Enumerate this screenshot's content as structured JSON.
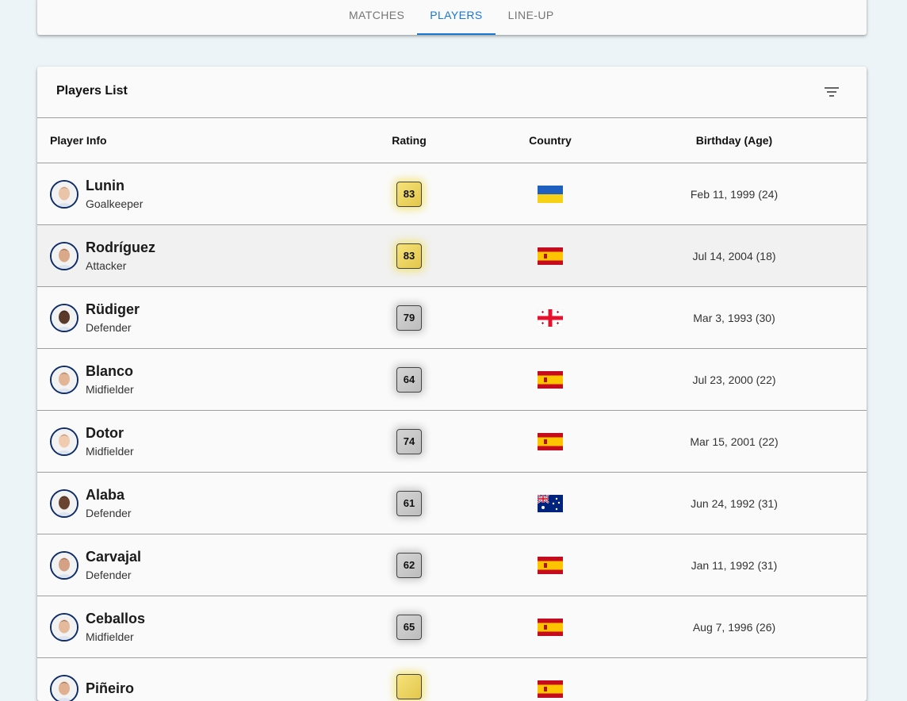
{
  "tabs": [
    {
      "label": "MATCHES",
      "active": false
    },
    {
      "label": "PLAYERS",
      "active": true
    },
    {
      "label": "LINE-UP",
      "active": false
    }
  ],
  "list": {
    "title": "Players List",
    "filter_icon": "filter-icon",
    "columns": {
      "info": "Player Info",
      "rating": "Rating",
      "country": "Country",
      "birthday": "Birthday (Age)"
    },
    "players": [
      {
        "name": "Lunin",
        "position": "Goalkeeper",
        "rating": "83",
        "tier": "gold",
        "country_flag": "ukraine-flag",
        "birthday": "Feb 11, 1999 (24)"
      },
      {
        "name": "Rodríguez",
        "position": "Attacker",
        "rating": "83",
        "tier": "gold",
        "country_flag": "spain-flag",
        "birthday": "Jul 14, 2004 (18)"
      },
      {
        "name": "Rüdiger",
        "position": "Defender",
        "rating": "79",
        "tier": "silver",
        "country_flag": "georgia-flag",
        "birthday": "Mar 3, 1993 (30)"
      },
      {
        "name": "Blanco",
        "position": "Midfielder",
        "rating": "64",
        "tier": "silver",
        "country_flag": "spain-flag",
        "birthday": "Jul 23, 2000 (22)"
      },
      {
        "name": "Dotor",
        "position": "Midfielder",
        "rating": "74",
        "tier": "silver",
        "country_flag": "spain-flag",
        "birthday": "Mar 15, 2001 (22)"
      },
      {
        "name": "Alaba",
        "position": "Defender",
        "rating": "61",
        "tier": "silver",
        "country_flag": "australia-flag",
        "birthday": "Jun 24, 1992 (31)"
      },
      {
        "name": "Carvajal",
        "position": "Defender",
        "rating": "62",
        "tier": "silver",
        "country_flag": "spain-flag",
        "birthday": "Jan 11, 1992 (31)"
      },
      {
        "name": "Ceballos",
        "position": "Midfielder",
        "rating": "65",
        "tier": "silver",
        "country_flag": "spain-flag",
        "birthday": "Aug 7, 1996 (26)"
      },
      {
        "name": "Piñeiro",
        "position": "",
        "rating": "",
        "tier": "gold",
        "country_flag": "spain-flag",
        "birthday": ""
      }
    ]
  },
  "colors": {
    "accent": "#1976d2",
    "background": "#edf4f7",
    "card": "#fafafa",
    "gold_badge": "#ecd35f",
    "silver_badge": "#c8c8c8",
    "avatar_border": "#0d2c6b"
  }
}
